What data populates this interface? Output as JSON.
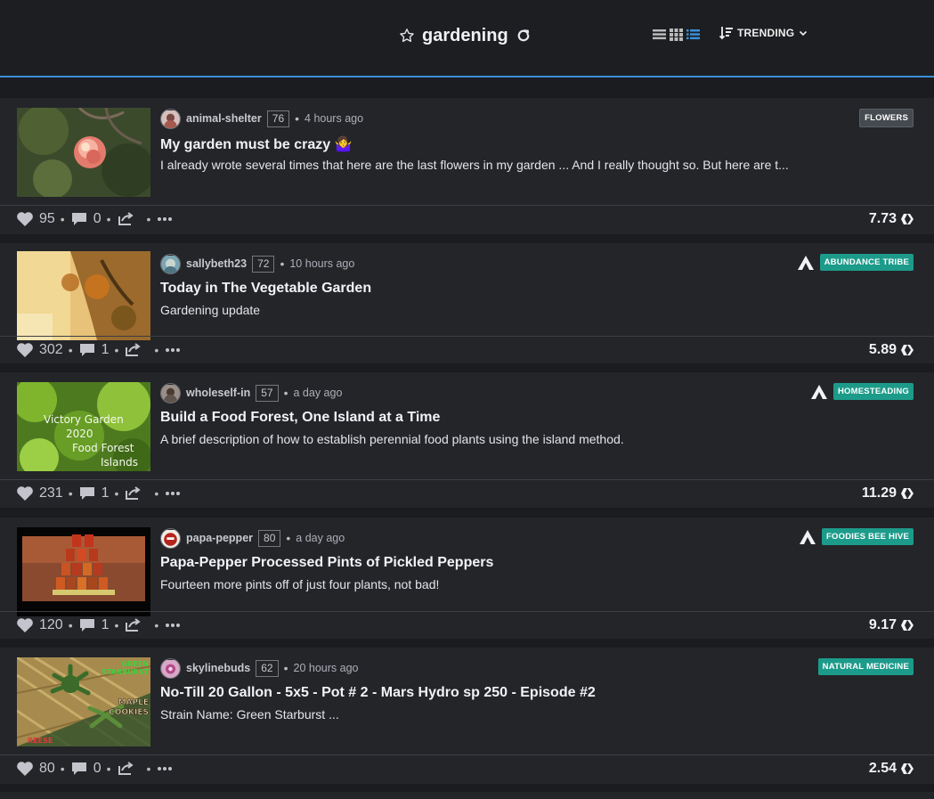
{
  "header": {
    "tag": "gardening",
    "sort_label": "TRENDING"
  },
  "colors": {
    "accent": "#3a8fd9",
    "community_badge": "#1d9b8a",
    "tag_badge": "#454a50"
  },
  "posts": [
    {
      "author": "animal-shelter",
      "reputation": "76",
      "time": "4 hours ago",
      "title": "My garden must be crazy 🤷‍♀️",
      "summary": "I already wrote several times that here are the last flowers in my garden ... And I really thought so. But here are t...",
      "badge": "FLOWERS",
      "votes": "95",
      "comments": "0",
      "payout": "7.73"
    },
    {
      "author": "sallybeth23",
      "reputation": "72",
      "time": "10 hours ago",
      "title": "Today in The Vegetable Garden",
      "summary": "Gardening update",
      "badge": "ABUNDANCE TRIBE",
      "votes": "302",
      "comments": "1",
      "payout": "5.89"
    },
    {
      "author": "wholeself-in",
      "reputation": "57",
      "time": "a day ago",
      "title": "Build a Food Forest, One Island at a Time",
      "summary": "A brief description of how to establish perennial food plants using the island method.",
      "badge": "HOMESTEADING",
      "thumb_text": [
        "Victory Garden",
        "2020",
        "Food Forest",
        "Islands"
      ],
      "votes": "231",
      "comments": "1",
      "payout": "11.29"
    },
    {
      "author": "papa-pepper",
      "reputation": "80",
      "time": "a day ago",
      "title": "Papa-Pepper Processed Pints of Pickled Peppers",
      "summary": "Fourteen more pints off of just four plants, not bad!",
      "badge": "FOODIES BEE HIVE",
      "votes": "120",
      "comments": "1",
      "payout": "9.17"
    },
    {
      "author": "skylinebuds",
      "reputation": "62",
      "time": "20 hours ago",
      "title": "No-Till 20 Gallon - 5x5 - Pot # 2 - Mars Hydro sp 250 - Episode #2",
      "summary": "Strain Name: Green Starburst ...",
      "badge": "NATURAL MEDICINE",
      "thumb_text": [
        "GREEN",
        "STARBURST",
        "MAPLE",
        "COOKIES",
        "REESE"
      ],
      "votes": "80",
      "comments": "0",
      "payout": "2.54"
    }
  ]
}
